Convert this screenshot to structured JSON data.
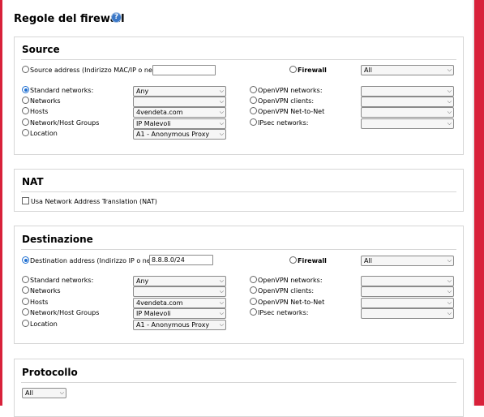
{
  "page": {
    "title": "Regole del firewall",
    "help_icon": "?"
  },
  "source": {
    "title": "Source",
    "address_label": "Source address (Indirizzo MAC/IP o network):",
    "address_value": "",
    "firewall_label": "Firewall",
    "firewall_value": "All",
    "left": [
      {
        "label": "Standard networks:",
        "value": "Any",
        "checked": true
      },
      {
        "label": "Networks",
        "value": ""
      },
      {
        "label": "Hosts",
        "value": "4vendeta.com"
      },
      {
        "label": "Network/Host Groups",
        "value": "IP Malevoli"
      },
      {
        "label": "Location",
        "value": "A1 - Anonymous Proxy"
      }
    ],
    "right": [
      {
        "label": "OpenVPN networks:",
        "value": ""
      },
      {
        "label": "OpenVPN clients:",
        "value": ""
      },
      {
        "label": "OpenVPN Net-to-Net",
        "value": ""
      },
      {
        "label": "IPsec networks:",
        "value": ""
      }
    ]
  },
  "nat": {
    "title": "NAT",
    "checkbox_label": "Usa Network Address Translation (NAT)"
  },
  "destination": {
    "title": "Destinazione",
    "address_label": "Destination address (Indirizzo IP o network):",
    "address_value": "8.8.8.0/24",
    "firewall_label": "Firewall",
    "firewall_value": "All",
    "left": [
      {
        "label": "Standard networks:",
        "value": "Any"
      },
      {
        "label": "Networks",
        "value": ""
      },
      {
        "label": "Hosts",
        "value": "4vendeta.com"
      },
      {
        "label": "Network/Host Groups",
        "value": "IP Malevoli"
      },
      {
        "label": "Location",
        "value": "A1 - Anonymous Proxy"
      }
    ],
    "right": [
      {
        "label": "OpenVPN networks:",
        "value": ""
      },
      {
        "label": "OpenVPN clients:",
        "value": ""
      },
      {
        "label": "OpenVPN Net-to-Net",
        "value": ""
      },
      {
        "label": "IPsec networks:",
        "value": ""
      }
    ]
  },
  "protocol": {
    "title": "Protocollo",
    "value": "All"
  },
  "colors": {
    "frame": "#d8213a",
    "radio_selected": "#1f6fd1",
    "help_icon": "#3b78c7"
  },
  "icons": {
    "select_arrow": "chevron-down-icon",
    "help": "help-icon"
  }
}
